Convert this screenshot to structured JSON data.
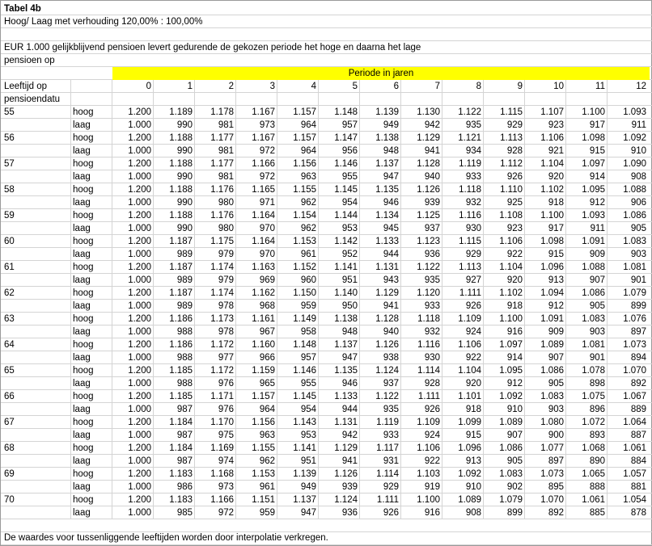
{
  "table_title": "Tabel 4b",
  "subtitle": "Hoog/ Laag met verhouding 120,00% : 100,00%",
  "description_line1": "EUR 1.000 gelijkblijvend pensioen levert gedurende de gekozen periode het hoge en daarna het lage",
  "description_line2": "pensioen op",
  "period_header": "Periode in jaren",
  "age_header_line1": "Leeftijd op",
  "age_header_line2": "pensioendatu",
  "periods": [
    "0",
    "1",
    "2",
    "3",
    "4",
    "5",
    "6",
    "7",
    "8",
    "9",
    "10",
    "11",
    "12"
  ],
  "footer_note": "De waardes voor tussenliggende leeftijden worden door interpolatie verkregen.",
  "colors": {
    "period_band": "#ffff00",
    "gridline": "#d4d4d4",
    "border": "#9a9a9a"
  },
  "rows": [
    {
      "age": "55",
      "hoog": [
        "1.200",
        "1.189",
        "1.178",
        "1.167",
        "1.157",
        "1.148",
        "1.139",
        "1.130",
        "1.122",
        "1.115",
        "1.107",
        "1.100",
        "1.093"
      ],
      "laag": [
        "1.000",
        "990",
        "981",
        "973",
        "964",
        "957",
        "949",
        "942",
        "935",
        "929",
        "923",
        "917",
        "911"
      ]
    },
    {
      "age": "56",
      "hoog": [
        "1.200",
        "1.188",
        "1.177",
        "1.167",
        "1.157",
        "1.147",
        "1.138",
        "1.129",
        "1.121",
        "1.113",
        "1.106",
        "1.098",
        "1.092"
      ],
      "laag": [
        "1.000",
        "990",
        "981",
        "972",
        "964",
        "956",
        "948",
        "941",
        "934",
        "928",
        "921",
        "915",
        "910"
      ]
    },
    {
      "age": "57",
      "hoog": [
        "1.200",
        "1.188",
        "1.177",
        "1.166",
        "1.156",
        "1.146",
        "1.137",
        "1.128",
        "1.119",
        "1.112",
        "1.104",
        "1.097",
        "1.090"
      ],
      "laag": [
        "1.000",
        "990",
        "981",
        "972",
        "963",
        "955",
        "947",
        "940",
        "933",
        "926",
        "920",
        "914",
        "908"
      ]
    },
    {
      "age": "58",
      "hoog": [
        "1.200",
        "1.188",
        "1.176",
        "1.165",
        "1.155",
        "1.145",
        "1.135",
        "1.126",
        "1.118",
        "1.110",
        "1.102",
        "1.095",
        "1.088"
      ],
      "laag": [
        "1.000",
        "990",
        "980",
        "971",
        "962",
        "954",
        "946",
        "939",
        "932",
        "925",
        "918",
        "912",
        "906"
      ]
    },
    {
      "age": "59",
      "hoog": [
        "1.200",
        "1.188",
        "1.176",
        "1.164",
        "1.154",
        "1.144",
        "1.134",
        "1.125",
        "1.116",
        "1.108",
        "1.100",
        "1.093",
        "1.086"
      ],
      "laag": [
        "1.000",
        "990",
        "980",
        "970",
        "962",
        "953",
        "945",
        "937",
        "930",
        "923",
        "917",
        "911",
        "905"
      ]
    },
    {
      "age": "60",
      "hoog": [
        "1.200",
        "1.187",
        "1.175",
        "1.164",
        "1.153",
        "1.142",
        "1.133",
        "1.123",
        "1.115",
        "1.106",
        "1.098",
        "1.091",
        "1.083"
      ],
      "laag": [
        "1.000",
        "989",
        "979",
        "970",
        "961",
        "952",
        "944",
        "936",
        "929",
        "922",
        "915",
        "909",
        "903"
      ]
    },
    {
      "age": "61",
      "hoog": [
        "1.200",
        "1.187",
        "1.174",
        "1.163",
        "1.152",
        "1.141",
        "1.131",
        "1.122",
        "1.113",
        "1.104",
        "1.096",
        "1.088",
        "1.081"
      ],
      "laag": [
        "1.000",
        "989",
        "979",
        "969",
        "960",
        "951",
        "943",
        "935",
        "927",
        "920",
        "913",
        "907",
        "901"
      ]
    },
    {
      "age": "62",
      "hoog": [
        "1.200",
        "1.187",
        "1.174",
        "1.162",
        "1.150",
        "1.140",
        "1.129",
        "1.120",
        "1.111",
        "1.102",
        "1.094",
        "1.086",
        "1.079"
      ],
      "laag": [
        "1.000",
        "989",
        "978",
        "968",
        "959",
        "950",
        "941",
        "933",
        "926",
        "918",
        "912",
        "905",
        "899"
      ]
    },
    {
      "age": "63",
      "hoog": [
        "1.200",
        "1.186",
        "1.173",
        "1.161",
        "1.149",
        "1.138",
        "1.128",
        "1.118",
        "1.109",
        "1.100",
        "1.091",
        "1.083",
        "1.076"
      ],
      "laag": [
        "1.000",
        "988",
        "978",
        "967",
        "958",
        "948",
        "940",
        "932",
        "924",
        "916",
        "909",
        "903",
        "897"
      ]
    },
    {
      "age": "64",
      "hoog": [
        "1.200",
        "1.186",
        "1.172",
        "1.160",
        "1.148",
        "1.137",
        "1.126",
        "1.116",
        "1.106",
        "1.097",
        "1.089",
        "1.081",
        "1.073"
      ],
      "laag": [
        "1.000",
        "988",
        "977",
        "966",
        "957",
        "947",
        "938",
        "930",
        "922",
        "914",
        "907",
        "901",
        "894"
      ]
    },
    {
      "age": "65",
      "hoog": [
        "1.200",
        "1.185",
        "1.172",
        "1.159",
        "1.146",
        "1.135",
        "1.124",
        "1.114",
        "1.104",
        "1.095",
        "1.086",
        "1.078",
        "1.070"
      ],
      "laag": [
        "1.000",
        "988",
        "976",
        "965",
        "955",
        "946",
        "937",
        "928",
        "920",
        "912",
        "905",
        "898",
        "892"
      ]
    },
    {
      "age": "66",
      "hoog": [
        "1.200",
        "1.185",
        "1.171",
        "1.157",
        "1.145",
        "1.133",
        "1.122",
        "1.111",
        "1.101",
        "1.092",
        "1.083",
        "1.075",
        "1.067"
      ],
      "laag": [
        "1.000",
        "987",
        "976",
        "964",
        "954",
        "944",
        "935",
        "926",
        "918",
        "910",
        "903",
        "896",
        "889"
      ]
    },
    {
      "age": "67",
      "hoog": [
        "1.200",
        "1.184",
        "1.170",
        "1.156",
        "1.143",
        "1.131",
        "1.119",
        "1.109",
        "1.099",
        "1.089",
        "1.080",
        "1.072",
        "1.064"
      ],
      "laag": [
        "1.000",
        "987",
        "975",
        "963",
        "953",
        "942",
        "933",
        "924",
        "915",
        "907",
        "900",
        "893",
        "887"
      ]
    },
    {
      "age": "68",
      "hoog": [
        "1.200",
        "1.184",
        "1.169",
        "1.155",
        "1.141",
        "1.129",
        "1.117",
        "1.106",
        "1.096",
        "1.086",
        "1.077",
        "1.068",
        "1.061"
      ],
      "laag": [
        "1.000",
        "987",
        "974",
        "962",
        "951",
        "941",
        "931",
        "922",
        "913",
        "905",
        "897",
        "890",
        "884"
      ]
    },
    {
      "age": "69",
      "hoog": [
        "1.200",
        "1.183",
        "1.168",
        "1.153",
        "1.139",
        "1.126",
        "1.114",
        "1.103",
        "1.092",
        "1.083",
        "1.073",
        "1.065",
        "1.057"
      ],
      "laag": [
        "1.000",
        "986",
        "973",
        "961",
        "949",
        "939",
        "929",
        "919",
        "910",
        "902",
        "895",
        "888",
        "881"
      ]
    },
    {
      "age": "70",
      "hoog": [
        "1.200",
        "1.183",
        "1.166",
        "1.151",
        "1.137",
        "1.124",
        "1.111",
        "1.100",
        "1.089",
        "1.079",
        "1.070",
        "1.061",
        "1.054"
      ],
      "laag": [
        "1.000",
        "985",
        "972",
        "959",
        "947",
        "936",
        "926",
        "916",
        "908",
        "899",
        "892",
        "885",
        "878"
      ]
    }
  ],
  "labels": {
    "hoog": "hoog",
    "laag": "laag"
  }
}
